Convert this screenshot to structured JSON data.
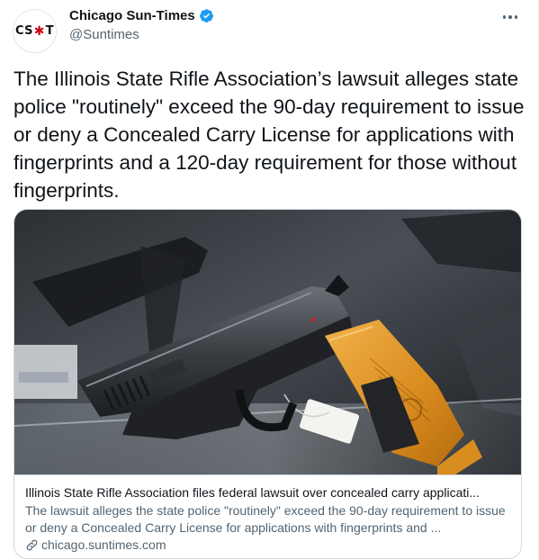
{
  "account": {
    "display_name": "Chicago Sun-Times",
    "handle": "@Suntimes",
    "avatar_text_left": "CS",
    "avatar_star": "✱",
    "avatar_text_right": "T",
    "verified_icon": "verified-badge-icon"
  },
  "tweet": {
    "text": "The Illinois State Rifle Association’s lawsuit alleges state police \"routinely\" exceed the 90-day requirement to issue or deny a Concealed Carry License for applications with fingerprints and a 120-day requirement for those without fingerprints."
  },
  "card": {
    "image_description": "handgun-in-display-case",
    "title": "Illinois State Rifle Association files federal lawsuit over concealed carry applicati...",
    "description": "The lawsuit alleges the state police \"routinely\" exceed the 90-day requirement to issue or deny a Concealed Carry License for applications with fingerprints and ...",
    "domain": "chicago.suntimes.com"
  },
  "colors": {
    "text_primary": "#0f1419",
    "text_secondary": "#536471",
    "verified_blue": "#1d9bf0",
    "border": "#cfd9de",
    "grip_orange": "#e49a2a"
  }
}
